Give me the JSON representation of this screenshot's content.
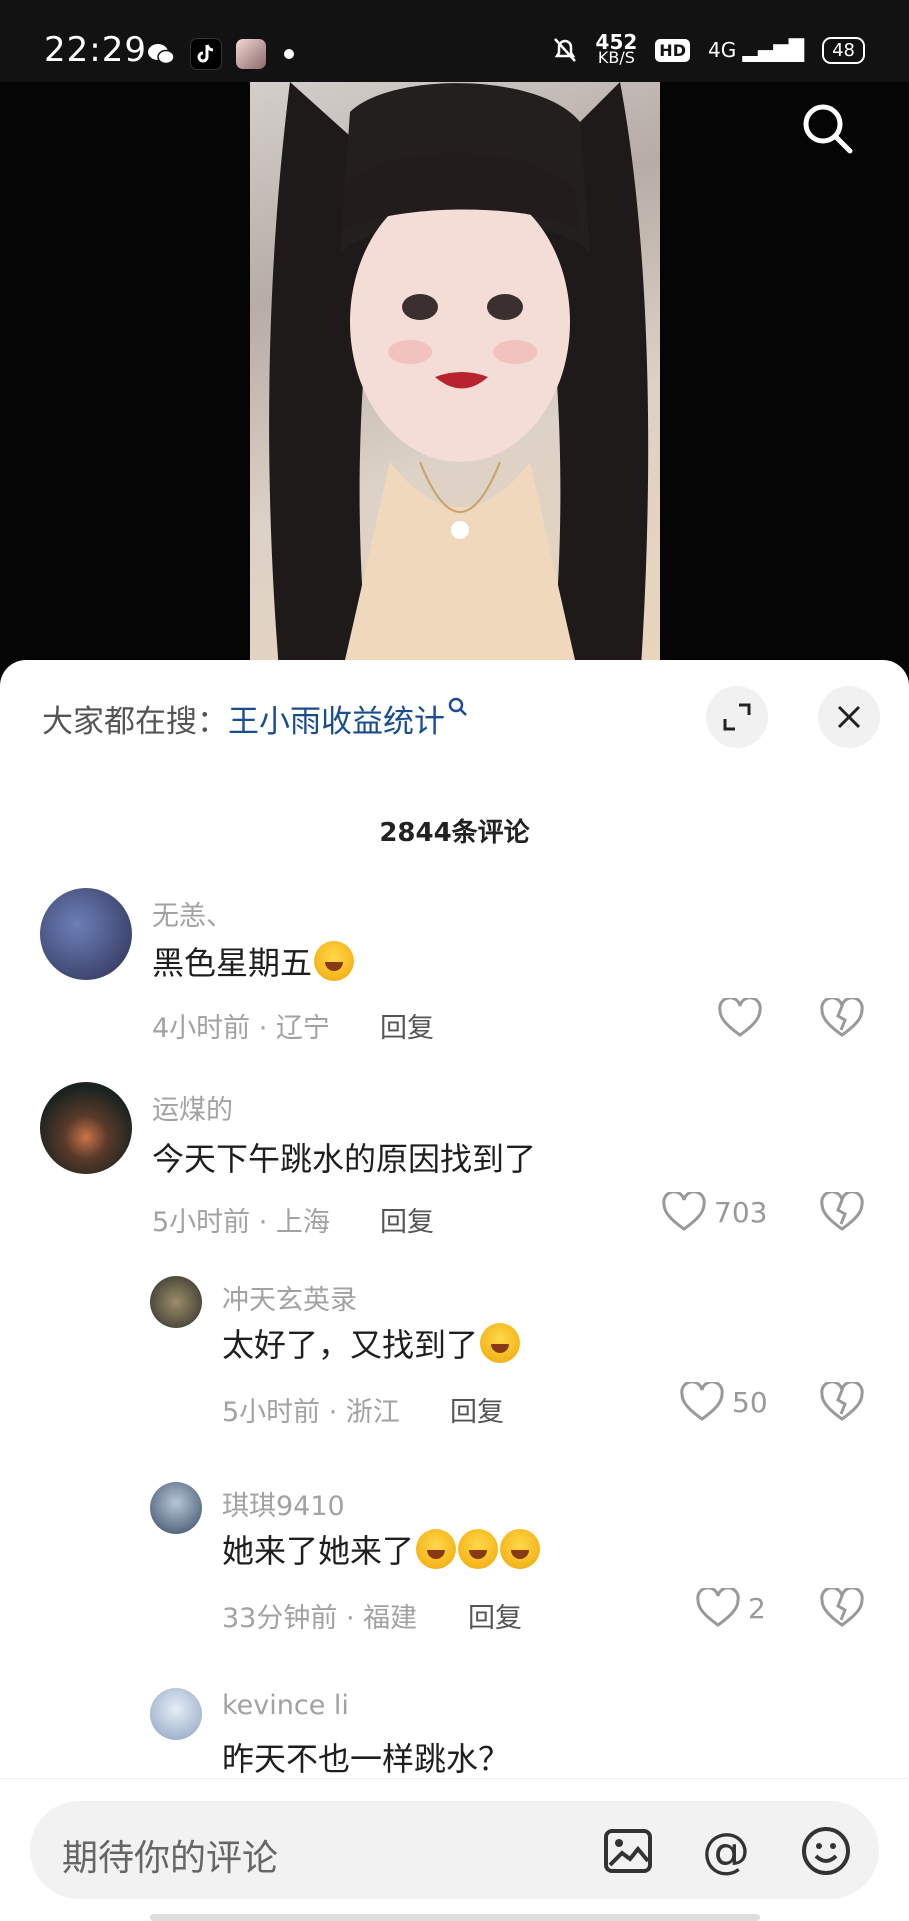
{
  "status_bar": {
    "time": "22:29",
    "net_speed": "452",
    "net_unit": "KB/S",
    "hd": "HD",
    "signal": "4G",
    "battery": "48"
  },
  "video": {
    "search_icon": "search-icon"
  },
  "sheet": {
    "hot_search_prefix": "大家都在搜：",
    "hot_search_term": "王小雨收益统计",
    "expand_icon": "expand-icon",
    "close_icon": "close-icon",
    "comment_count": "2844条评论"
  },
  "comments": [
    {
      "user": "无恙、",
      "text": "黑色星期五",
      "meta": "4小时前 · 辽宁",
      "reply": "回复",
      "likes": ""
    },
    {
      "user": "运煤的",
      "text": "今天下午跳水的原因找到了",
      "meta": "5小时前 · 上海",
      "reply": "回复",
      "likes": "703"
    },
    {
      "user": "冲天玄英录",
      "text": "太好了，又找到了",
      "meta": "5小时前 · 浙江",
      "reply": "回复",
      "likes": "50"
    },
    {
      "user": "琪琪9410",
      "text": "她来了她来了",
      "meta": "33分钟前 · 福建",
      "reply": "回复",
      "likes": "2"
    },
    {
      "user": "kevince li",
      "text": "昨天不也一样跳水？",
      "meta": "",
      "reply": "",
      "likes": ""
    }
  ],
  "composer": {
    "placeholder": "期待你的评论",
    "image_icon": "image-icon",
    "mention_icon": "at-icon",
    "emoji_icon": "emoji-icon"
  }
}
